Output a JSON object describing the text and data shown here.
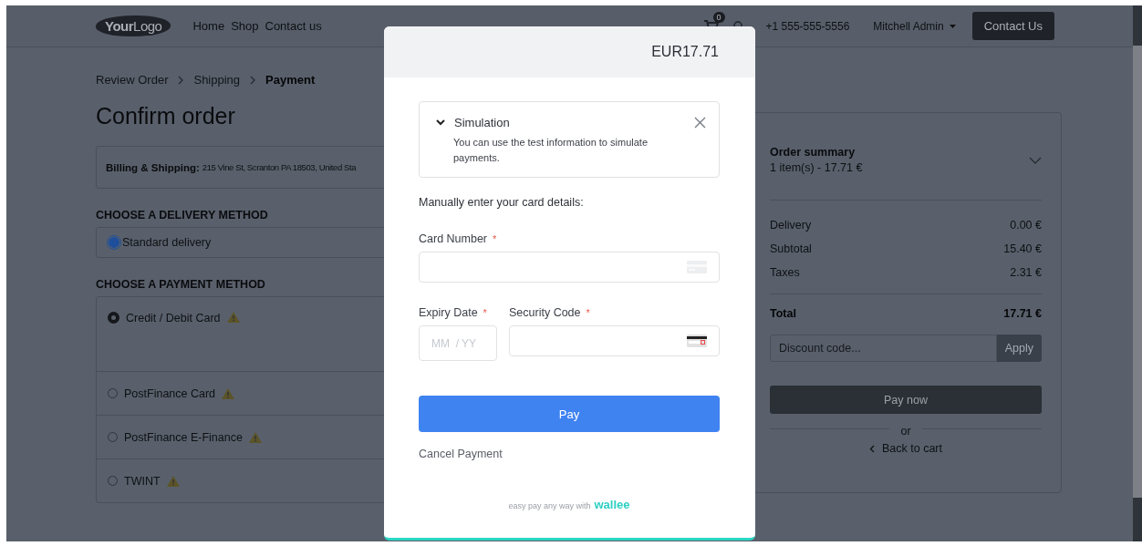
{
  "header": {
    "logo": {
      "part_1": "Your",
      "part_2": "Logo"
    },
    "nav": [
      {
        "label": "Home"
      },
      {
        "label": "Shop"
      },
      {
        "label": "Contact us"
      }
    ],
    "cart_count": "0",
    "phone": "+1 555-555-5556",
    "user": "Mitchell Admin",
    "contact_button": "Contact Us"
  },
  "breadcrumb": [
    {
      "label": "Review Order",
      "current": false
    },
    {
      "label": "Shipping",
      "current": false
    },
    {
      "label": "Payment",
      "current": true
    }
  ],
  "title": "Confirm order",
  "billing": {
    "label": "Billing & Shipping:",
    "address": "215 Vine St, Scranton PA 18503, United Sta"
  },
  "delivery": {
    "heading": "CHOOSE A DELIVERY METHOD",
    "options": [
      {
        "label": "Standard delivery",
        "selected": true
      }
    ]
  },
  "payment": {
    "heading": "CHOOSE A PAYMENT METHOD",
    "methods": [
      {
        "label": "Credit / Debit Card",
        "selected": true,
        "warning": true
      },
      {
        "label": "PostFinance Card",
        "selected": false,
        "warning": true
      },
      {
        "label": "PostFinance E-Finance",
        "selected": false,
        "warning": true
      },
      {
        "label": "TWINT",
        "selected": false,
        "warning": true
      }
    ]
  },
  "summary": {
    "title": "Order summary",
    "items": "1 item(s) -  17.71 €",
    "expanded": false,
    "lines": [
      {
        "label": "Delivery",
        "value": "0.00 €",
        "bold": false
      },
      {
        "label": "Subtotal",
        "value": "15.40 €",
        "bold": false
      },
      {
        "label": "Taxes",
        "value": "2.31 €",
        "bold": false
      }
    ],
    "total": {
      "label": "Total",
      "value": "17.71 €"
    },
    "discount": {
      "placeholder": "Discount code..."
    },
    "apply": "Apply",
    "pay_now": "Pay now",
    "or": "or",
    "back": "Back to cart"
  },
  "modal": {
    "amount": "EUR17.71",
    "simulation": {
      "title": "Simulation",
      "text": "You can use the test information to simulate payments.",
      "expanded": true
    },
    "intro": "Manually enter your card details:",
    "card_number": {
      "label": "Card Number",
      "required_mark": "*"
    },
    "expiry": {
      "label": "Expiry Date",
      "required_mark": "*",
      "placeholder": "MM  / YY"
    },
    "security": {
      "label": "Security Code",
      "required_mark": "*"
    },
    "pay": "Pay",
    "cancel": "Cancel Payment",
    "footer": "easy pay any way with",
    "brand": "wallee"
  }
}
